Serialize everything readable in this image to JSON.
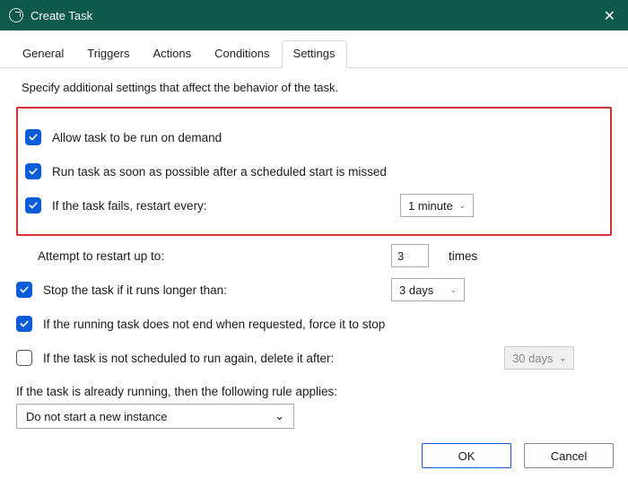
{
  "window": {
    "title": "Create Task",
    "close_glyph": "✕"
  },
  "tabs": {
    "general": "General",
    "triggers": "Triggers",
    "actions": "Actions",
    "conditions": "Conditions",
    "settings": "Settings"
  },
  "subtitle": "Specify additional settings that affect the behavior of the task.",
  "options": {
    "allow_on_demand": "Allow task to be run on demand",
    "run_asap": "Run task as soon as possible after a scheduled start is missed",
    "restart_every": "If the task fails, restart every:",
    "restart_interval": "1 minute",
    "attempt_label": "Attempt to restart up to:",
    "attempt_value": "3",
    "attempt_suffix": "times",
    "stop_if_longer": "Stop the task if it runs longer than:",
    "stop_duration": "3 days",
    "force_stop": "If the running task does not end when requested, force it to stop",
    "delete_after": "If the task is not scheduled to run again, delete it after:",
    "delete_after_value": "30 days",
    "rule_intro": "If the task is already running, then the following rule applies:",
    "rule_value": "Do not start a new instance"
  },
  "buttons": {
    "ok": "OK",
    "cancel": "Cancel"
  },
  "glyphs": {
    "caret": "⌄"
  }
}
